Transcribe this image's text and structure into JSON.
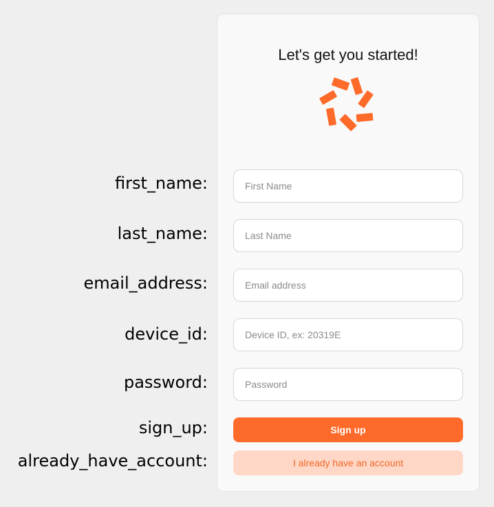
{
  "card": {
    "title": "Let's get you started!",
    "logo_icon": "orange-spinner-logo",
    "accent_color": "#fd6a2a"
  },
  "labels": {
    "first_name": "first_name:",
    "last_name": "last_name:",
    "email_address": "email_address:",
    "device_id": "device_id:",
    "password": "password:",
    "sign_up": "sign_up:",
    "already_have_account": "already_have_account:"
  },
  "fields": {
    "first_name": {
      "placeholder": "First Name",
      "value": ""
    },
    "last_name": {
      "placeholder": "Last Name",
      "value": ""
    },
    "email_address": {
      "placeholder": "Email address",
      "value": ""
    },
    "device_id": {
      "placeholder": "Device ID, ex: 20319E",
      "value": ""
    },
    "password": {
      "placeholder": "Password",
      "value": ""
    }
  },
  "buttons": {
    "sign_up": "Sign up",
    "already_have_account": "I already have an account"
  }
}
